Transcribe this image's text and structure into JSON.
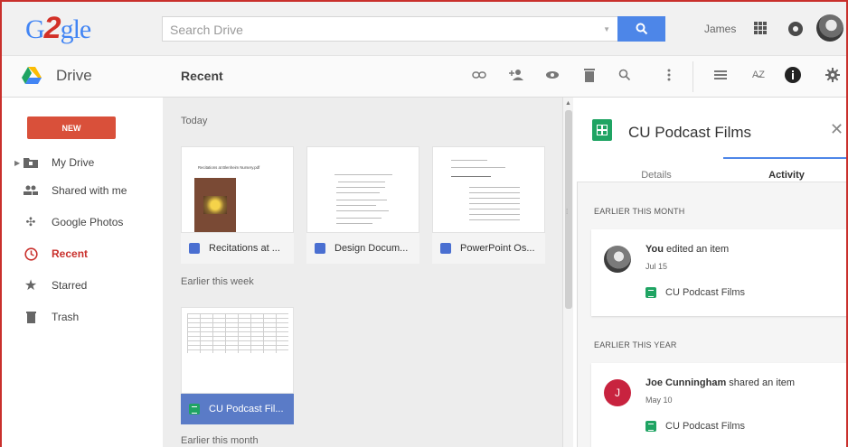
{
  "header": {
    "logo_text": "gle",
    "step_number": "2",
    "search_placeholder": "Search Drive",
    "user_name": "James"
  },
  "subheader": {
    "app_label": "Drive",
    "page_title": "Recent"
  },
  "toolbar_icons": [
    "link-icon",
    "add-person-icon",
    "preview-icon",
    "trash-icon",
    "search-icon",
    "more-vert-icon",
    "list-view-icon",
    "sort-az-icon",
    "info-icon",
    "settings-icon"
  ],
  "sidebar": {
    "new_label": "NEW",
    "items": [
      {
        "label": "My Drive",
        "icon": "folder-icon"
      },
      {
        "label": "Shared with me",
        "icon": "people-icon"
      },
      {
        "label": "Google Photos",
        "icon": "pinwheel-icon"
      },
      {
        "label": "Recent",
        "icon": "clock-icon"
      },
      {
        "label": "Starred",
        "icon": "star-icon"
      },
      {
        "label": "Trash",
        "icon": "trash-icon"
      }
    ]
  },
  "main": {
    "sections": [
      "Today",
      "Earlier this week",
      "Earlier this month"
    ],
    "files_today": [
      {
        "name": "Recitations at ...",
        "type": "doc",
        "preview_title": "Recitations at Blenheim Nursery.pdf"
      },
      {
        "name": "Design Docum...",
        "type": "doc"
      },
      {
        "name": "PowerPoint Os...",
        "type": "doc"
      }
    ],
    "files_week": [
      {
        "name": "CU Podcast Fil...",
        "type": "sheet"
      }
    ]
  },
  "details_panel": {
    "title": "CU Podcast Films",
    "tabs": [
      "Details",
      "Activity"
    ],
    "groups": [
      {
        "label": "EARLIER THIS MONTH",
        "actor": "You",
        "action": " edited an item",
        "date": "Jul 15",
        "file": "CU Podcast Films"
      },
      {
        "label": "EARLIER THIS YEAR",
        "actor": "Joe Cunningham",
        "action": " shared an item",
        "date": "May 10",
        "avatar_letter": "J",
        "file": "CU Podcast Films"
      }
    ]
  },
  "colors": {
    "accent_red": "#c9302c",
    "new_button": "#d9503a",
    "search_blue": "#4d86e8",
    "selected_file": "#5a7bc7",
    "sheet_green": "#1fa463",
    "doc_blue": "#4a6fd1"
  }
}
